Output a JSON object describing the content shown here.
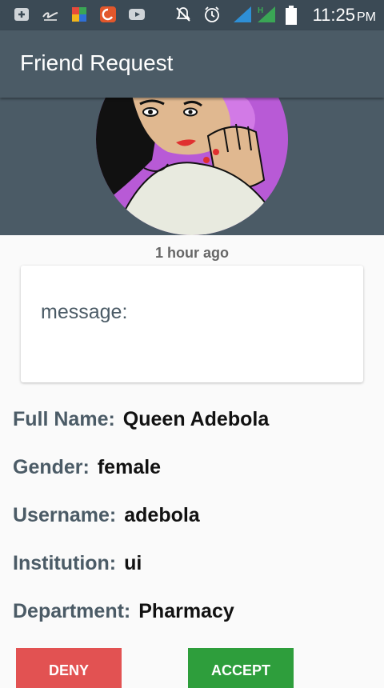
{
  "status_bar": {
    "time": "11:25",
    "ampm": "PM",
    "icons": [
      "add-box-icon",
      "signature-icon",
      "multicolor-app-icon",
      "shield-app-icon",
      "youtube-icon",
      "mute-icon",
      "alarm-icon",
      "signal-icon",
      "signal-h-icon",
      "battery-icon"
    ]
  },
  "app_bar": {
    "title": "Friend Request"
  },
  "request": {
    "time_ago": "1 hour ago",
    "message_label": "message:"
  },
  "details": [
    {
      "label": "Full Name:",
      "value": "Queen Adebola"
    },
    {
      "label": "Gender:",
      "value": "female"
    },
    {
      "label": "Username:",
      "value": "adebola"
    },
    {
      "label": "Institution:",
      "value": "ui"
    },
    {
      "label": "Department:",
      "value": "Pharmacy"
    }
  ],
  "actions": {
    "deny": "DENY",
    "accept": "ACCEPT"
  },
  "colors": {
    "toolbar": "#4b5b66",
    "deny": "#e25252",
    "accept": "#2e9e3c"
  }
}
